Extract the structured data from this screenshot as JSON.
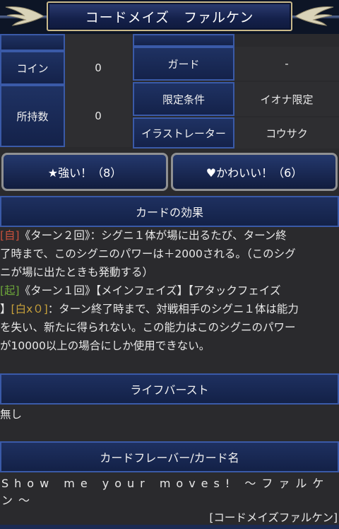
{
  "header": {
    "title": "コードメイズ　ファルケン"
  },
  "stats": {
    "coin_label": "コイン",
    "coin_value": "0",
    "owned_label": "所持数",
    "owned_value": "0",
    "guard_label": "ガード",
    "guard_value": "-",
    "limit_label": "限定条件",
    "limit_value": "イオナ限定",
    "illustrator_label": "イラストレーター",
    "illustrator_value": "コウサク"
  },
  "votes": {
    "strong": "★強い！（8）",
    "cute": "♥かわいい！（6）"
  },
  "effect": {
    "heading": "カードの効果",
    "l1_tag": "[自]",
    "l1_a": "《ターン２回》：シグニ１体が場に出るたび、ターン終",
    "l2": "了時まで、このシグニのパワーは＋2000される。（このシグ",
    "l3": "ニが場に出たときも発動する）",
    "l4_tag": "[起]",
    "l4_a": "《ターン１回》【メインフェイズ】【アタックフェイズ",
    "l5_a": "】",
    "l5_tag": "[白x０]",
    "l5_b": "：ターン終了時まで、対戦相手のシグニ１体は能力",
    "l6": "を失い、新たに得られない。この能力はこのシグニのパワー",
    "l7": "が10000以上の場合にしか使用できない。"
  },
  "lifeburst": {
    "heading": "ライフバースト",
    "text": "無し"
  },
  "flavor": {
    "heading": "カードフレーバー/カード名",
    "text": "Show me your moves! ～ファルケン～",
    "name": "[コードメイズファルケン]"
  }
}
